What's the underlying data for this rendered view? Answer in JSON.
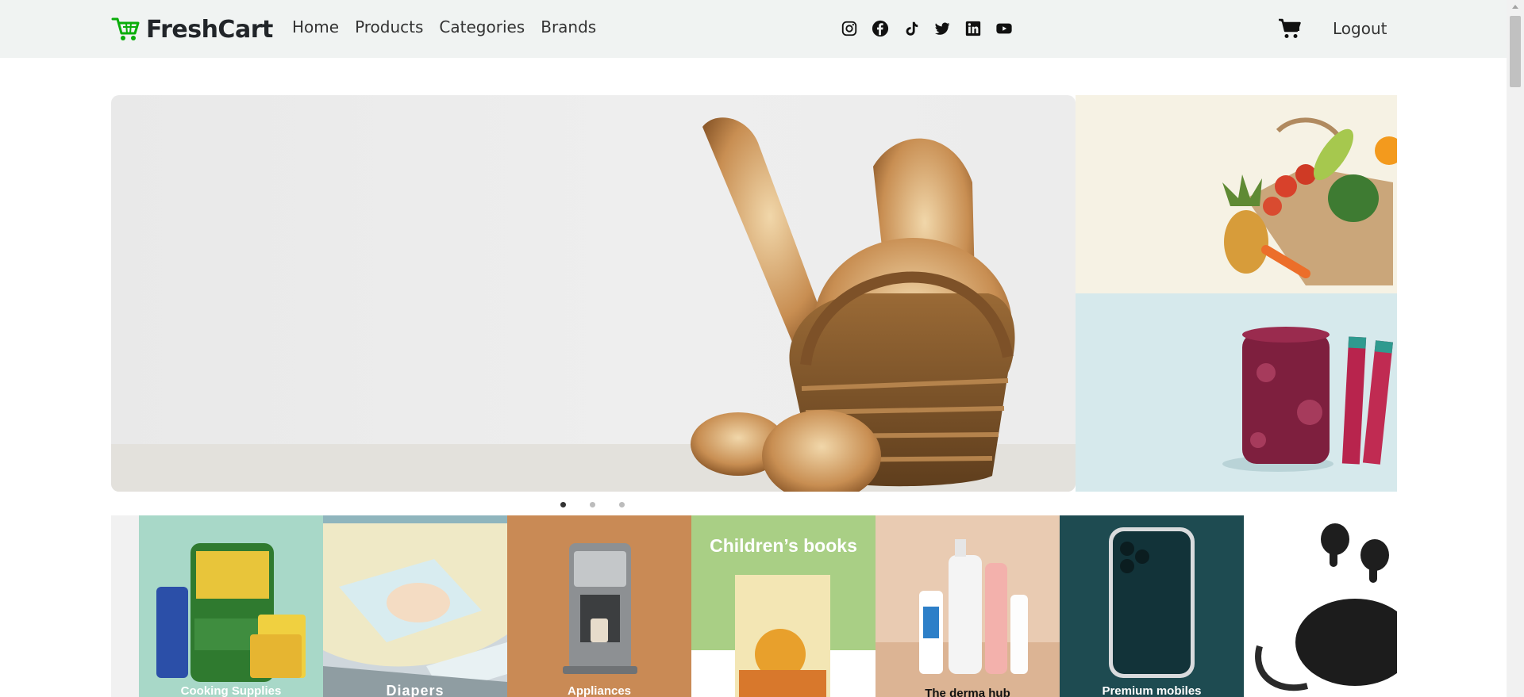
{
  "brand": {
    "name": "FreshCart"
  },
  "nav": {
    "links": [
      "Home",
      "Products",
      "Categories",
      "Brands"
    ],
    "logout": "Logout"
  },
  "socials": [
    "instagram-icon",
    "facebook-icon",
    "tiktok-icon",
    "twitter-icon",
    "linkedin-icon",
    "youtube-icon"
  ],
  "colors": {
    "accent": "#0aad0a",
    "navbar_bg": "#f0f3f2"
  },
  "slider": {
    "active_index": 0,
    "count": 3
  },
  "categories": [
    {
      "label": "Cooking Supplies",
      "bg": "#a8d8c8"
    },
    {
      "label": "Diapers",
      "bg": "#cfd7dc"
    },
    {
      "label": "Appliances",
      "bg": "#c98a55"
    },
    {
      "label": "Children’s books",
      "bg": "#a9cf85"
    },
    {
      "label": "The derma hub",
      "bg": "#e9cbb2"
    },
    {
      "label": "Premium mobiles",
      "bg": "#1e4b51"
    }
  ]
}
